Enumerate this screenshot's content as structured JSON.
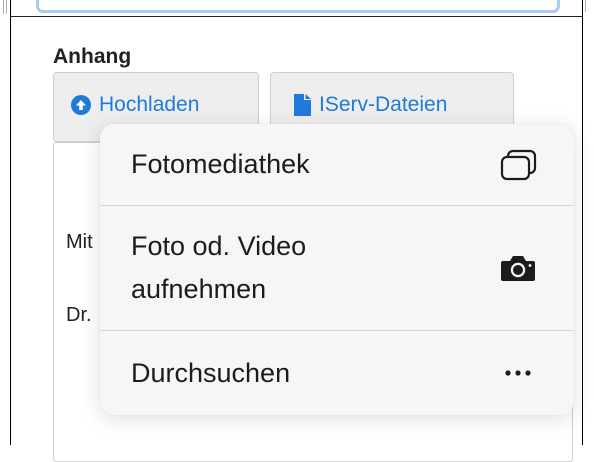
{
  "attachments": {
    "heading": "Anhang",
    "upload_button": "Hochladen",
    "iserv_button": "IServ-Dateien"
  },
  "background_text": {
    "line1": "Mit",
    "line2": "Dr."
  },
  "upload_menu": {
    "items": [
      {
        "label": "Fotomediathek",
        "icon": "photo-library-icon"
      },
      {
        "label": "Foto od. Video aufnehmen",
        "icon": "camera-icon"
      },
      {
        "label": "Durchsuchen",
        "icon": "more-icon"
      }
    ]
  },
  "colors": {
    "accent": "#1f7ad9",
    "field_border": "#a8cbef",
    "menu_background": "#f6f6f6"
  }
}
